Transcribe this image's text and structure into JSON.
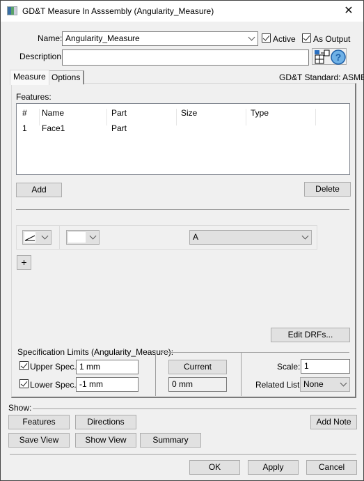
{
  "window": {
    "title": "GD&T Measure In Asssembly (Angularity_Measure)",
    "close_glyph": "✕"
  },
  "header": {
    "name_label": "Name:",
    "name_value": "Angularity_Measure",
    "active_label": "Active",
    "active_checked": true,
    "as_output_label": "As Output",
    "as_output_checked": true,
    "description_label": "Description:",
    "description_value": ""
  },
  "tabs": [
    {
      "label": "Measure",
      "active": true
    },
    {
      "label": "Options",
      "active": false
    }
  ],
  "gdt_standard": "GD&T Standard: ASME",
  "features": {
    "label": "Features:",
    "columns": [
      "#",
      "Name",
      "Part",
      "Size",
      "Type"
    ],
    "rows": [
      {
        "num": "1",
        "name": "Face1",
        "part": "Part",
        "size": "",
        "type": ""
      }
    ],
    "add_label": "Add",
    "delete_label": "Delete"
  },
  "fcf": {
    "symbol_icon": "angularity-icon",
    "modifier_value": "",
    "datum_value": "A",
    "plus_label": "+"
  },
  "edit_drfs_label": "Edit DRFs...",
  "spec_limits": {
    "title": "Specification Limits (Angularity_Measure):",
    "upper_label": "Upper Spec.:",
    "upper_checked": true,
    "upper_value": "1 mm",
    "lower_label": "Lower Spec.:",
    "lower_checked": true,
    "lower_value": "-1 mm",
    "current_label": "Current",
    "current_value": "0 mm",
    "scale_label": "Scale:",
    "scale_value": "1",
    "related_list_label": "Related List:",
    "related_list_value": "None"
  },
  "show": {
    "label": "Show:",
    "features_label": "Features",
    "directions_label": "Directions",
    "add_note_label": "Add Note",
    "save_view_label": "Save View",
    "show_view_label": "Show View",
    "summary_label": "Summary"
  },
  "footer": {
    "ok_label": "OK",
    "apply_label": "Apply",
    "cancel_label": "Cancel"
  }
}
